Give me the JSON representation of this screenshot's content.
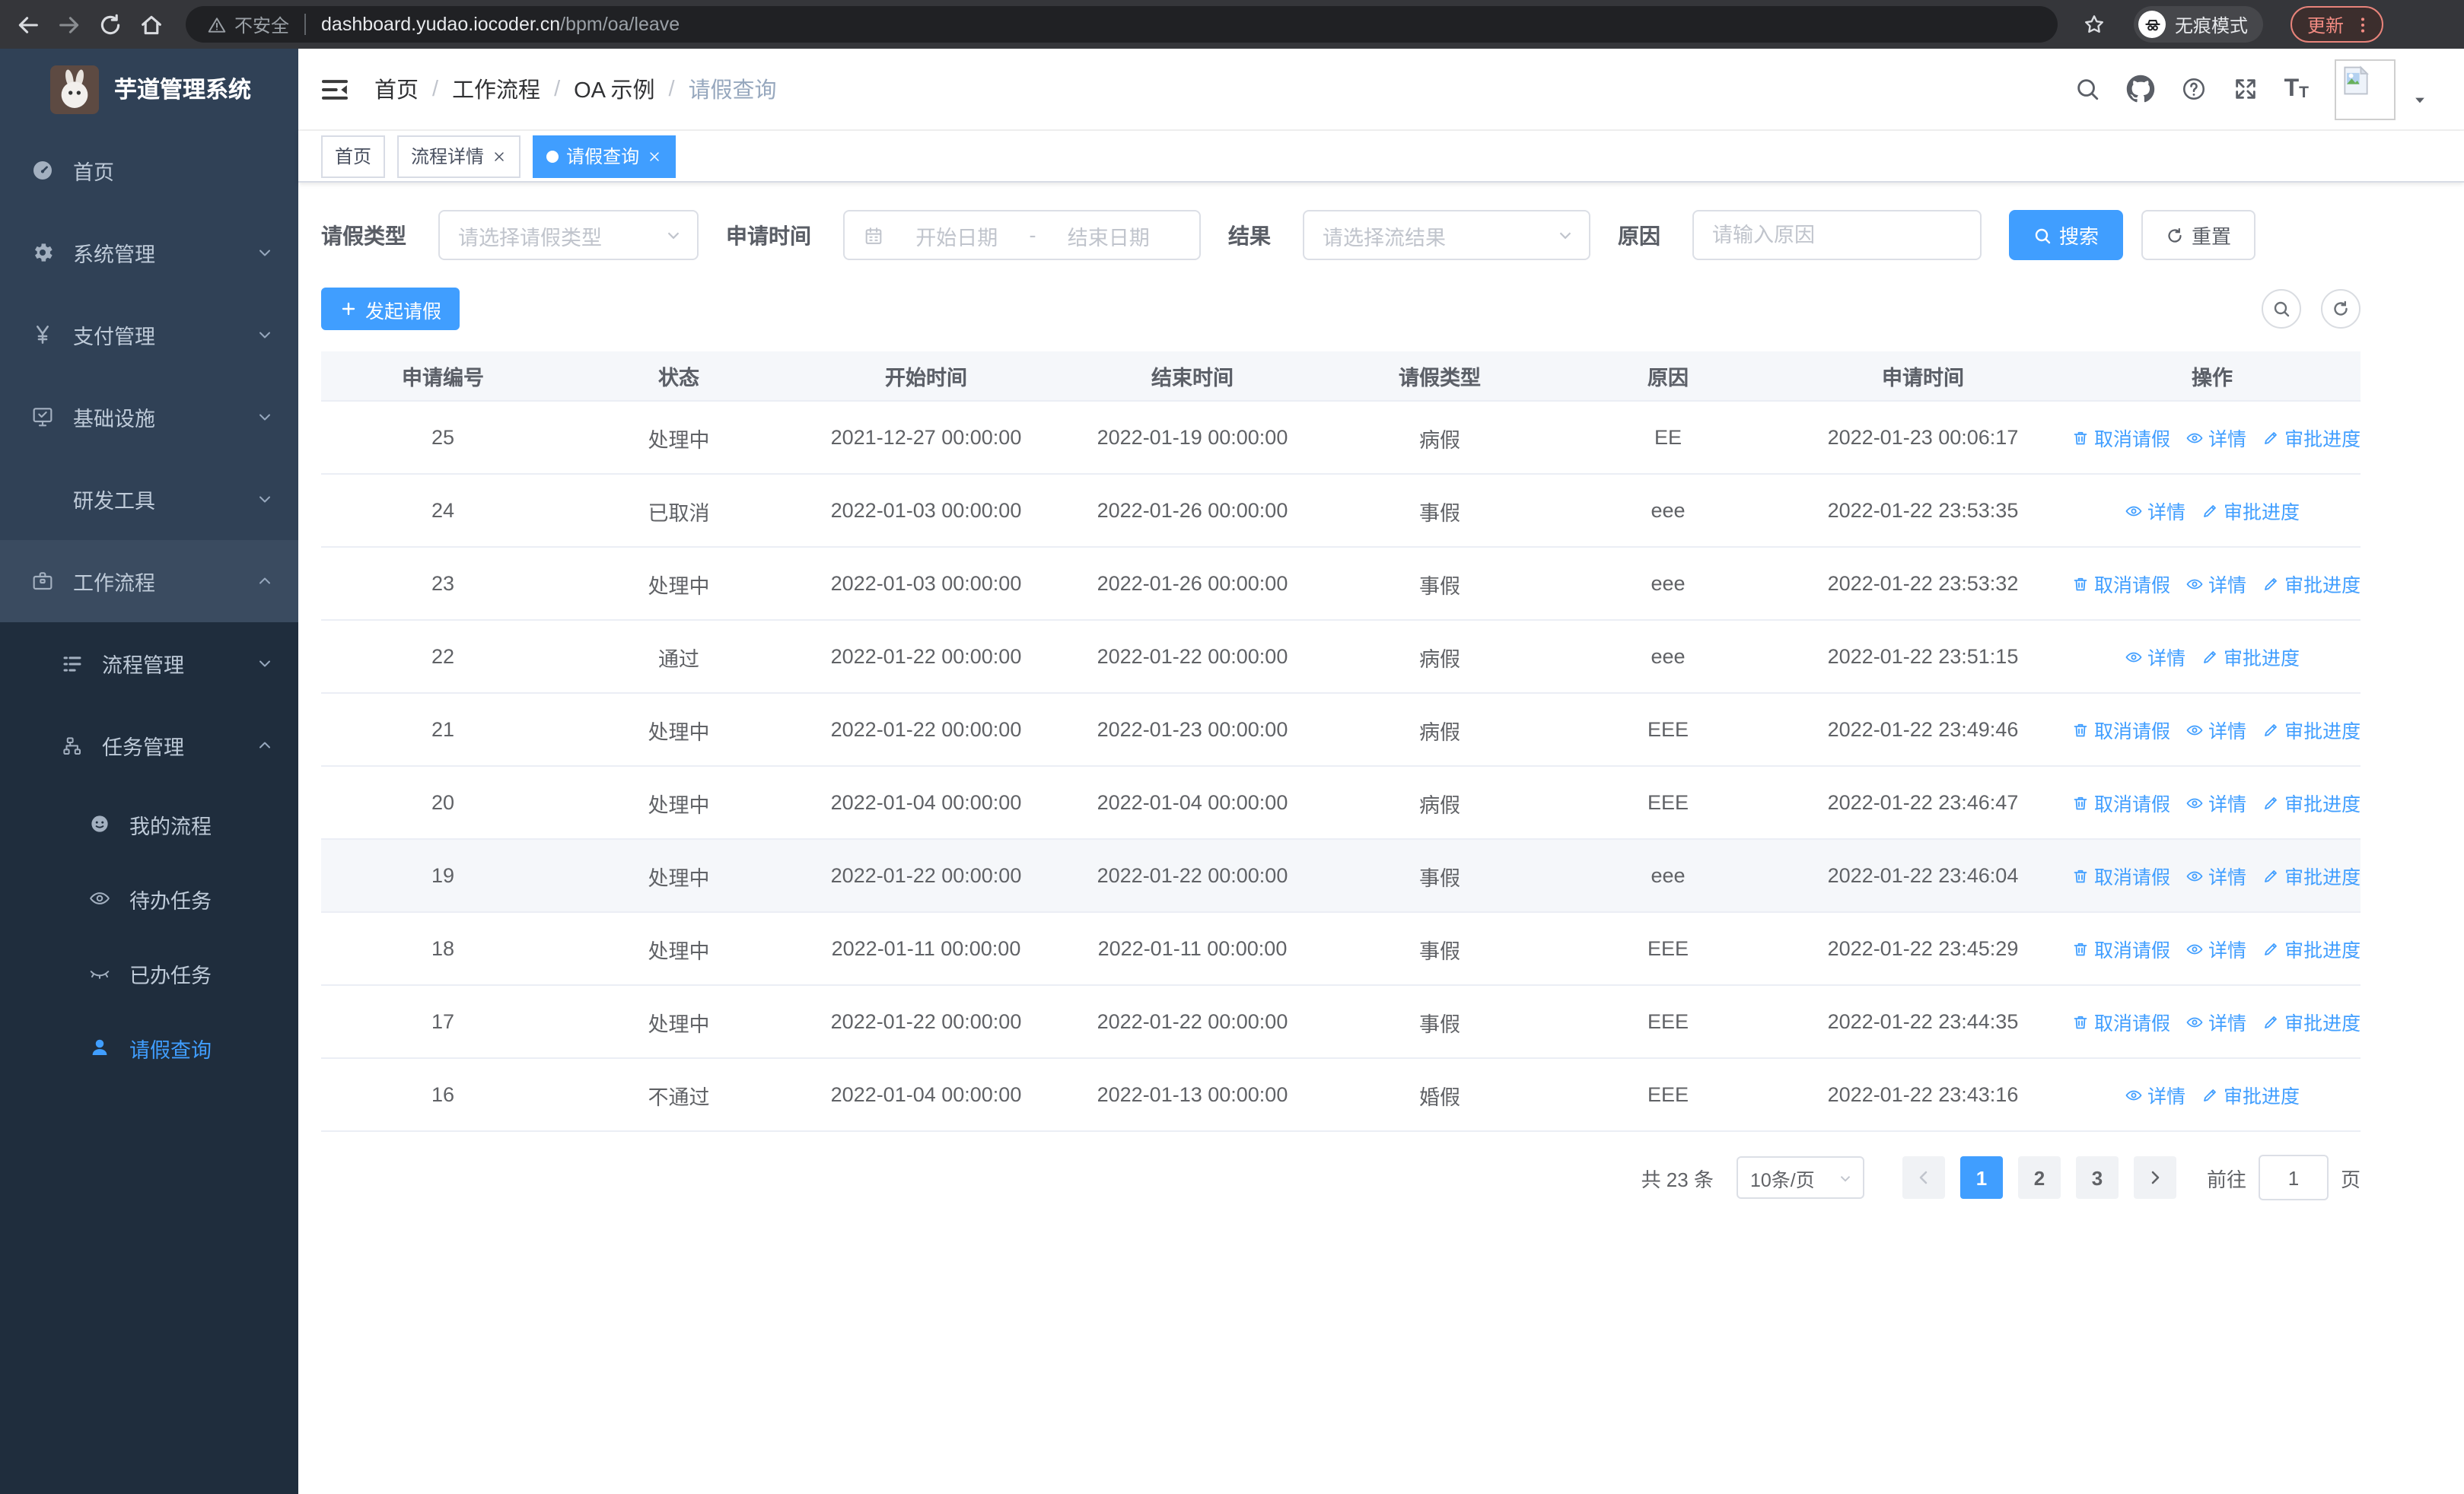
{
  "browser": {
    "security_label": "不安全",
    "url_host": "dashboard.yudao.iocoder.cn",
    "url_path": "/bpm/oa/leave",
    "incognito_label": "无痕模式",
    "update_label": "更新"
  },
  "sidebar": {
    "title": "芋道管理系统",
    "menu": [
      {
        "label": "首页",
        "icon": "dashboard-icon",
        "level": 1,
        "arrow": null,
        "dark": false,
        "active": false,
        "openroot": false
      },
      {
        "label": "系统管理",
        "icon": "gear-icon",
        "level": 1,
        "arrow": "down",
        "dark": false,
        "active": false,
        "openroot": false
      },
      {
        "label": "支付管理",
        "icon": "yen-icon",
        "level": 1,
        "arrow": "down",
        "dark": false,
        "active": false,
        "openroot": false
      },
      {
        "label": "基础设施",
        "icon": "monitor-icon",
        "level": 1,
        "arrow": "down",
        "dark": false,
        "active": false,
        "openroot": false
      },
      {
        "label": "研发工具",
        "icon": "toolbox-icon",
        "level": 1,
        "arrow": "down",
        "dark": false,
        "active": false,
        "openroot": false
      },
      {
        "label": "工作流程",
        "icon": "briefcase-icon",
        "level": 1,
        "arrow": "up",
        "dark": false,
        "active": false,
        "openroot": true
      },
      {
        "label": "流程管理",
        "icon": "process-list-icon",
        "level": 2,
        "arrow": "down",
        "dark": true,
        "active": false,
        "openroot": false
      },
      {
        "label": "任务管理",
        "icon": "task-tree-icon",
        "level": 2,
        "arrow": "up",
        "dark": true,
        "active": false,
        "openroot": false
      },
      {
        "label": "我的流程",
        "icon": "my-process-icon",
        "level": 3,
        "arrow": null,
        "dark": true,
        "active": false,
        "openroot": false
      },
      {
        "label": "待办任务",
        "icon": "eye-open-icon",
        "level": 3,
        "arrow": null,
        "dark": true,
        "active": false,
        "openroot": false
      },
      {
        "label": "已办任务",
        "icon": "eye-closed-icon",
        "level": 3,
        "arrow": null,
        "dark": true,
        "active": false,
        "openroot": false
      },
      {
        "label": "请假查询",
        "icon": "user-icon",
        "level": 3,
        "arrow": null,
        "dark": true,
        "active": true,
        "openroot": false
      }
    ]
  },
  "header": {
    "breadcrumb": [
      "首页",
      "工作流程",
      "OA 示例",
      "请假查询"
    ],
    "breadcrumb_separator": "/",
    "font_icon_letter_large": "T",
    "font_icon_letter_small": "T"
  },
  "tabs": [
    {
      "label": "首页",
      "closable": false,
      "active": false
    },
    {
      "label": "流程详情",
      "closable": true,
      "active": false
    },
    {
      "label": "请假查询",
      "closable": true,
      "active": true
    }
  ],
  "filters": {
    "leave_type": {
      "label": "请假类型",
      "placeholder": "请选择请假类型"
    },
    "apply_time": {
      "label": "申请时间",
      "start_placeholder": "开始日期",
      "separator": "-",
      "end_placeholder": "结束日期"
    },
    "result": {
      "label": "结果",
      "placeholder": "请选择流结果"
    },
    "reason": {
      "label": "原因",
      "placeholder": "请输入原因"
    },
    "search_label": "搜索",
    "reset_label": "重置"
  },
  "toolbar": {
    "create_label": "发起请假"
  },
  "table": {
    "columns": [
      "申请编号",
      "状态",
      "开始时间",
      "结束时间",
      "请假类型",
      "原因",
      "申请时间",
      "操作"
    ],
    "action_labels": {
      "cancel": "取消请假",
      "detail": "详情",
      "progress": "审批进度"
    },
    "rows": [
      {
        "id": "25",
        "status": "处理中",
        "start": "2021-12-27 00:00:00",
        "end": "2022-01-19 00:00:00",
        "type": "病假",
        "reason": "EE",
        "applied": "2022-01-23 00:06:17",
        "actions": [
          "cancel",
          "detail",
          "progress"
        ],
        "highlight": false
      },
      {
        "id": "24",
        "status": "已取消",
        "start": "2022-01-03 00:00:00",
        "end": "2022-01-26 00:00:00",
        "type": "事假",
        "reason": "eee",
        "applied": "2022-01-22 23:53:35",
        "actions": [
          "detail",
          "progress"
        ],
        "highlight": false
      },
      {
        "id": "23",
        "status": "处理中",
        "start": "2022-01-03 00:00:00",
        "end": "2022-01-26 00:00:00",
        "type": "事假",
        "reason": "eee",
        "applied": "2022-01-22 23:53:32",
        "actions": [
          "cancel",
          "detail",
          "progress"
        ],
        "highlight": false
      },
      {
        "id": "22",
        "status": "通过",
        "start": "2022-01-22 00:00:00",
        "end": "2022-01-22 00:00:00",
        "type": "病假",
        "reason": "eee",
        "applied": "2022-01-22 23:51:15",
        "actions": [
          "detail",
          "progress"
        ],
        "highlight": false
      },
      {
        "id": "21",
        "status": "处理中",
        "start": "2022-01-22 00:00:00",
        "end": "2022-01-23 00:00:00",
        "type": "病假",
        "reason": "EEE",
        "applied": "2022-01-22 23:49:46",
        "actions": [
          "cancel",
          "detail",
          "progress"
        ],
        "highlight": false
      },
      {
        "id": "20",
        "status": "处理中",
        "start": "2022-01-04 00:00:00",
        "end": "2022-01-04 00:00:00",
        "type": "病假",
        "reason": "EEE",
        "applied": "2022-01-22 23:46:47",
        "actions": [
          "cancel",
          "detail",
          "progress"
        ],
        "highlight": false
      },
      {
        "id": "19",
        "status": "处理中",
        "start": "2022-01-22 00:00:00",
        "end": "2022-01-22 00:00:00",
        "type": "事假",
        "reason": "eee",
        "applied": "2022-01-22 23:46:04",
        "actions": [
          "cancel",
          "detail",
          "progress"
        ],
        "highlight": true
      },
      {
        "id": "18",
        "status": "处理中",
        "start": "2022-01-11 00:00:00",
        "end": "2022-01-11 00:00:00",
        "type": "事假",
        "reason": "EEE",
        "applied": "2022-01-22 23:45:29",
        "actions": [
          "cancel",
          "detail",
          "progress"
        ],
        "highlight": false
      },
      {
        "id": "17",
        "status": "处理中",
        "start": "2022-01-22 00:00:00",
        "end": "2022-01-22 00:00:00",
        "type": "事假",
        "reason": "EEE",
        "applied": "2022-01-22 23:44:35",
        "actions": [
          "cancel",
          "detail",
          "progress"
        ],
        "highlight": false
      },
      {
        "id": "16",
        "status": "不通过",
        "start": "2022-01-04 00:00:00",
        "end": "2022-01-13 00:00:00",
        "type": "婚假",
        "reason": "EEE",
        "applied": "2022-01-22 23:43:16",
        "actions": [
          "detail",
          "progress"
        ],
        "highlight": false
      }
    ]
  },
  "pagination": {
    "total_label": "共 23 条",
    "page_size_label": "10条/页",
    "pages": [
      "1",
      "2",
      "3"
    ],
    "active_page": "1",
    "goto_label": "前往",
    "goto_value": "1",
    "page_unit": "页"
  },
  "colors": {
    "accent": "#409eff",
    "sidebar_bg": "#304156",
    "submenu_bg": "#1f2d3d",
    "update_chip": "#f28b82",
    "table_header_bg": "#f5f7fa"
  }
}
